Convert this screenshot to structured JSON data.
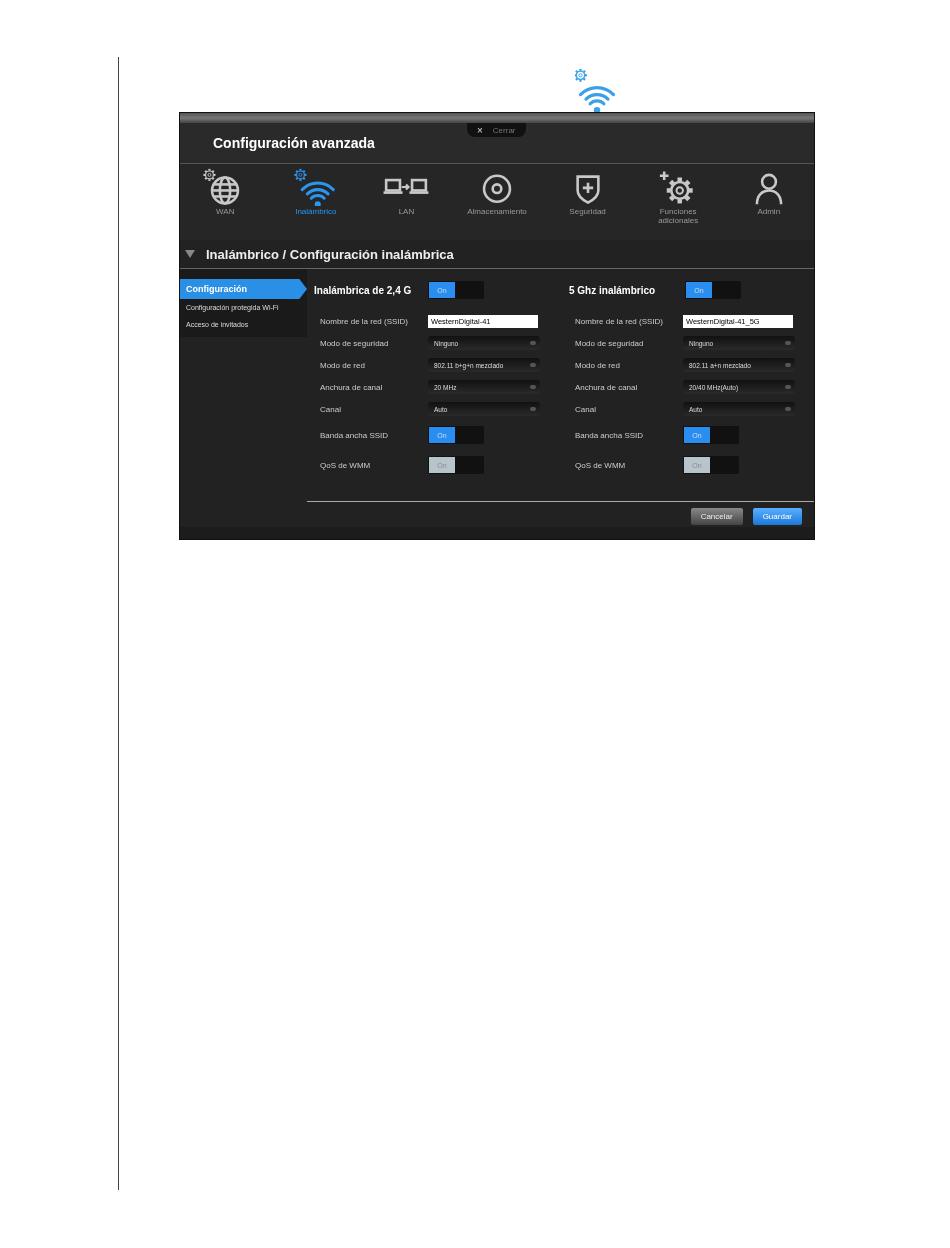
{
  "close_tab": {
    "icon": "×",
    "label": "Cerrar"
  },
  "window": {
    "title": "Configuración avanzada"
  },
  "nav": [
    {
      "kind": "globe",
      "label": "WAN",
      "selected": false
    },
    {
      "kind": "wifi",
      "label": "Inalámbrico",
      "selected": true
    },
    {
      "kind": "lan",
      "label": "LAN",
      "selected": false
    },
    {
      "kind": "disc",
      "label": "Almacenamiento",
      "selected": false
    },
    {
      "kind": "shield",
      "label": "Seguridad",
      "selected": false
    },
    {
      "kind": "gear",
      "label": "Funciones adicionales",
      "selected": false
    },
    {
      "kind": "person",
      "label": "Admin",
      "selected": false
    }
  ],
  "breadcrumb": "Inalámbrico / Configuración inalámbrica",
  "sidebar": {
    "items": [
      {
        "label": "Configuración",
        "selected": true
      },
      {
        "label": "Configuración protegida Wi-Fi",
        "selected": false
      },
      {
        "label": "Acceso de invitados",
        "selected": false
      }
    ]
  },
  "bands": [
    {
      "title": "Inalámbrica de 2,4 G",
      "toggle": {
        "label": "On",
        "on": true,
        "disabled": false
      },
      "rows": [
        {
          "kind": "text",
          "label": "Nombre de la red (SSID)",
          "value": "WesternDigital-41"
        },
        {
          "kind": "select",
          "label": "Modo de seguridad",
          "value": "Ninguno"
        },
        {
          "kind": "select",
          "label": "Modo de red",
          "value": "802.11 b+g+n mezclado"
        },
        {
          "kind": "select",
          "label": "Anchura de canal",
          "value": "20 MHz"
        },
        {
          "kind": "select",
          "label": "Canal",
          "value": "Auto"
        },
        {
          "kind": "toggle",
          "label": "Banda ancha SSID",
          "toggle": {
            "label": "On",
            "on": true,
            "disabled": false
          }
        },
        {
          "kind": "toggle",
          "label": "QoS de WMM",
          "toggle": {
            "label": "On",
            "on": true,
            "disabled": true
          }
        }
      ]
    },
    {
      "title": "5 Ghz inalámbrico",
      "toggle": {
        "label": "On",
        "on": true,
        "disabled": false
      },
      "rows": [
        {
          "kind": "text",
          "label": "Nombre de la red (SSID)",
          "value": "WesternDigital-41_5G"
        },
        {
          "kind": "select",
          "label": "Modo de seguridad",
          "value": "Ninguno"
        },
        {
          "kind": "select",
          "label": "Modo de red",
          "value": "802.11 a+n mezclado"
        },
        {
          "kind": "select",
          "label": "Anchura de canal",
          "value": "20/40 MHz(Auto)"
        },
        {
          "kind": "select",
          "label": "Canal",
          "value": "Auto"
        },
        {
          "kind": "toggle",
          "label": "Banda ancha SSID",
          "toggle": {
            "label": "On",
            "on": true,
            "disabled": false
          }
        },
        {
          "kind": "toggle",
          "label": "QoS de WMM",
          "toggle": {
            "label": "On",
            "on": true,
            "disabled": true
          }
        }
      ]
    }
  ],
  "buttons": [
    {
      "kind": "secondary",
      "label": "Cancelar"
    },
    {
      "kind": "primary",
      "label": "Guardar"
    }
  ]
}
